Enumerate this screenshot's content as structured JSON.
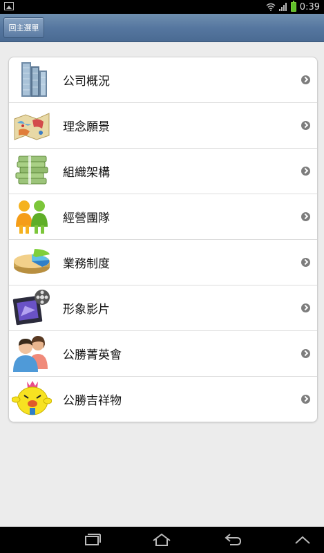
{
  "status": {
    "time": "0:39"
  },
  "header": {
    "back_label": "回主選單"
  },
  "menu": [
    {
      "label": "公司概況",
      "icon": "buildings-icon"
    },
    {
      "label": "理念願景",
      "icon": "map-icon"
    },
    {
      "label": "組織架構",
      "icon": "money-stack-icon"
    },
    {
      "label": "經營團隊",
      "icon": "people-icon"
    },
    {
      "label": "業務制度",
      "icon": "pie-chart-icon"
    },
    {
      "label": "形象影片",
      "icon": "film-icon"
    },
    {
      "label": "公勝菁英會",
      "icon": "users-icon"
    },
    {
      "label": "公勝吉祥物",
      "icon": "mascot-icon"
    }
  ]
}
